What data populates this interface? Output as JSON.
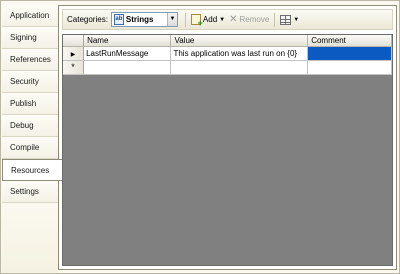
{
  "tabs": [
    "Application",
    "Signing",
    "References",
    "Security",
    "Publish",
    "Debug",
    "Compile",
    "Resources",
    "Settings"
  ],
  "selected_tab": "Resources",
  "toolbar": {
    "categories_label": "Categories:",
    "category_value": "Strings",
    "add_label": "Add",
    "remove_label": "Remove"
  },
  "grid": {
    "columns": [
      "Name",
      "Value",
      "Comment"
    ],
    "rows": [
      {
        "marker": "▶",
        "name": "LastRunMessage",
        "value": "This application was last run on {0}",
        "comment": ""
      },
      {
        "marker": "*",
        "name": "",
        "value": "",
        "comment": ""
      }
    ]
  },
  "colors": {
    "selection": "#0a5ac2",
    "grid_background": "#808080",
    "page_background": "#fbf9ef"
  }
}
